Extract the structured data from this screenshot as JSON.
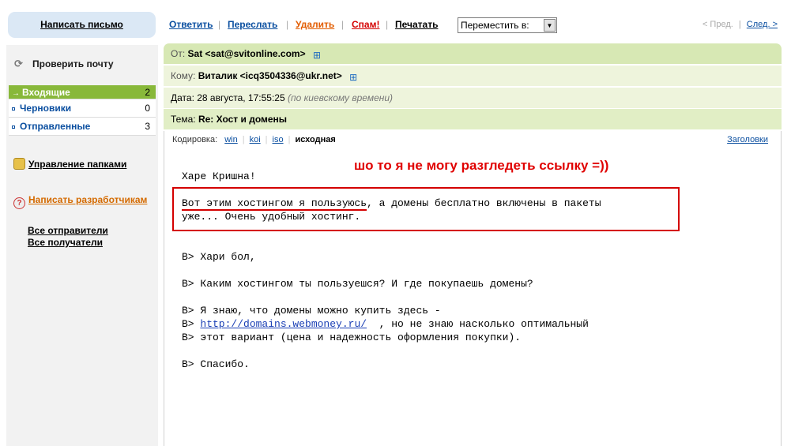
{
  "sidebar": {
    "compose": "Написать письмо",
    "check_mail": "Проверить почту",
    "folders": [
      {
        "label": "Входящие",
        "count": "2"
      },
      {
        "label": "Черновики",
        "count": "0"
      },
      {
        "label": "Отправленные",
        "count": "3"
      }
    ],
    "manage_folders": "Управление папками",
    "write_devs": "Написать разработчикам",
    "all_senders": "Все отправители",
    "all_recipients": "Все получатели"
  },
  "toolbar": {
    "reply": "Ответить",
    "forward": "Переслать",
    "delete": "Удалить",
    "spam": "Спам!",
    "print": "Печатать",
    "move_to": "Переместить в:",
    "prev": "< Пред.",
    "next": "След. >"
  },
  "header": {
    "from_label": "От:",
    "from_value": "Sat <sat@svitonline.com>",
    "to_label": "Кому:",
    "to_value": "Виталик <icq3504336@ukr.net>",
    "date_label": "Дата:",
    "date_value": "28 августа, 17:55:25",
    "date_note": "(по киевскому времени)",
    "subject_label": "Тема:",
    "subject_value": "Re: Хост и домены"
  },
  "encoding": {
    "label": "Кодировка:",
    "options": [
      "win",
      "koi",
      "iso"
    ],
    "current": "исходная",
    "headers_link": "Заголовки"
  },
  "message": {
    "greeting": "Харе Кришна!",
    "line1_underlined": "Вот этим хостингом я пользуюсь",
    "line1_rest": ", а домены бесплатно включены в пакеты",
    "line2": "уже... Очень удобный хостинг.",
    "q1": "B> Хари бол,",
    "q2": "B> Каким хостингом ты пользуешся? И где покупаешь домены?",
    "q3": "B> Я знаю, что домены можно купить здесь -",
    "q4_prefix": "B> ",
    "q4_link": "http://domains.webmoney.ru/",
    "q4_rest": "  , но не знаю насколько оптимальный",
    "q5": "B> этот вариант (цена и надежность оформления покупки).",
    "q6": "B> Спасибо."
  },
  "annotation": "шо то я не могу разгледеть ссылку =))"
}
